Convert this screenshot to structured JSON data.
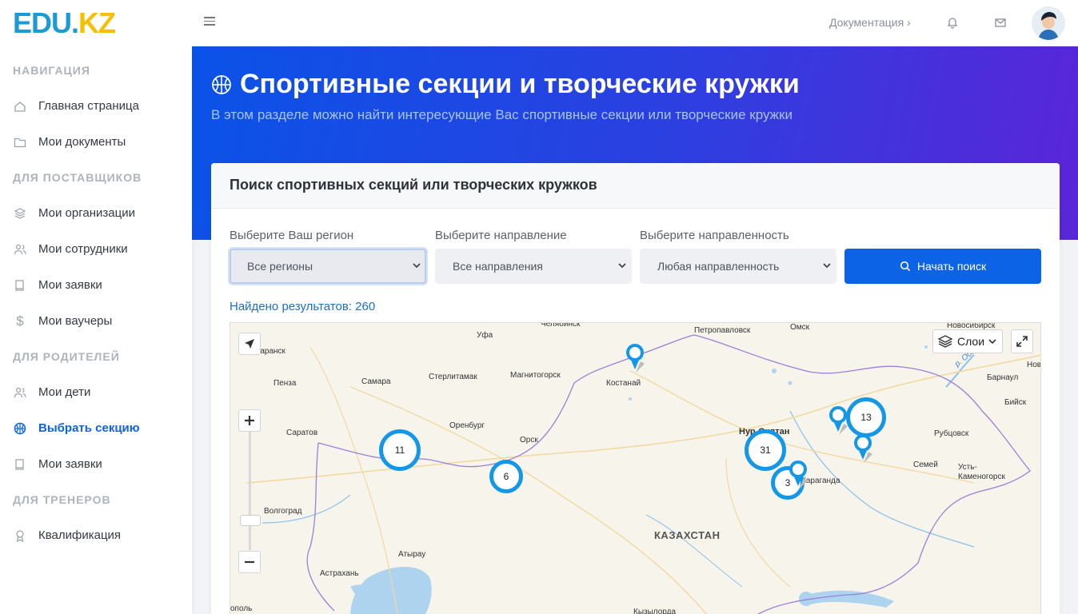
{
  "brand": {
    "logo_edu": "EDU",
    "logo_dot": ".",
    "logo_kz": "KZ"
  },
  "topbar": {
    "docs_label": "Документация ›"
  },
  "sidebar": {
    "sections": [
      {
        "title": "НАВИГАЦИЯ",
        "items": [
          {
            "label": "Главная страница",
            "icon": "home-icon"
          },
          {
            "label": "Мои документы",
            "icon": "folder-icon"
          }
        ]
      },
      {
        "title": "ДЛЯ ПОСТАВЩИКОВ",
        "items": [
          {
            "label": "Мои организации",
            "icon": "layers-icon"
          },
          {
            "label": "Мои сотрудники",
            "icon": "users-icon"
          },
          {
            "label": "Мои заявки",
            "icon": "book-icon"
          },
          {
            "label": "Мои ваучеры",
            "icon": "dollar-icon"
          }
        ]
      },
      {
        "title": "ДЛЯ РОДИТЕЛЕЙ",
        "items": [
          {
            "label": "Мои дети",
            "icon": "users-icon"
          },
          {
            "label": "Выбрать секцию",
            "icon": "basketball-icon",
            "active": true
          },
          {
            "label": "Мои заявки",
            "icon": "book-icon"
          }
        ]
      },
      {
        "title": "ДЛЯ ТРЕНЕРОВ",
        "items": [
          {
            "label": "Квалификация",
            "icon": "award-icon"
          }
        ]
      }
    ]
  },
  "hero": {
    "title": "Спортивные секции и творческие кружки",
    "subtitle": "В этом разделе можно найти интересующие Вас спортивные секции или творческие кружки"
  },
  "search_card": {
    "title": "Поиск спортивных секций или творческих кружков",
    "region_label": "Выберите Ваш регион",
    "region_value": "Все регионы",
    "direction_label": "Выберите направление",
    "direction_value": "Все направления",
    "focus_label": "Выберите направленность",
    "focus_value": "Любая направленность",
    "search_button": "Начать поиск",
    "results_text": "Найдено результатов: 260"
  },
  "map": {
    "layers_label": "Слои",
    "country_label": "КАЗАХСТАН",
    "cities": [
      "Челябинск",
      "Петропавловск",
      "Омск",
      "Новосибирск",
      "Уфа",
      "Саранск",
      "Стерлитамак",
      "Магнитогорск",
      "Костанай",
      "Пенза",
      "Самара",
      "Нур-Султан",
      "Оренбург",
      "Орск",
      "Саратов",
      "Барнаул",
      "Бийск",
      "Рубцовск",
      "Семей",
      "Усть-Каменогорск",
      "Волгоград",
      "Атырау",
      "Астрахань",
      "Нов",
      "р. Обь",
      "Караганда",
      "Кызылорда",
      "ополь"
    ],
    "clusters": [
      "11",
      "6",
      "31",
      "3",
      "13"
    ],
    "accent_color": "#1497e6"
  }
}
